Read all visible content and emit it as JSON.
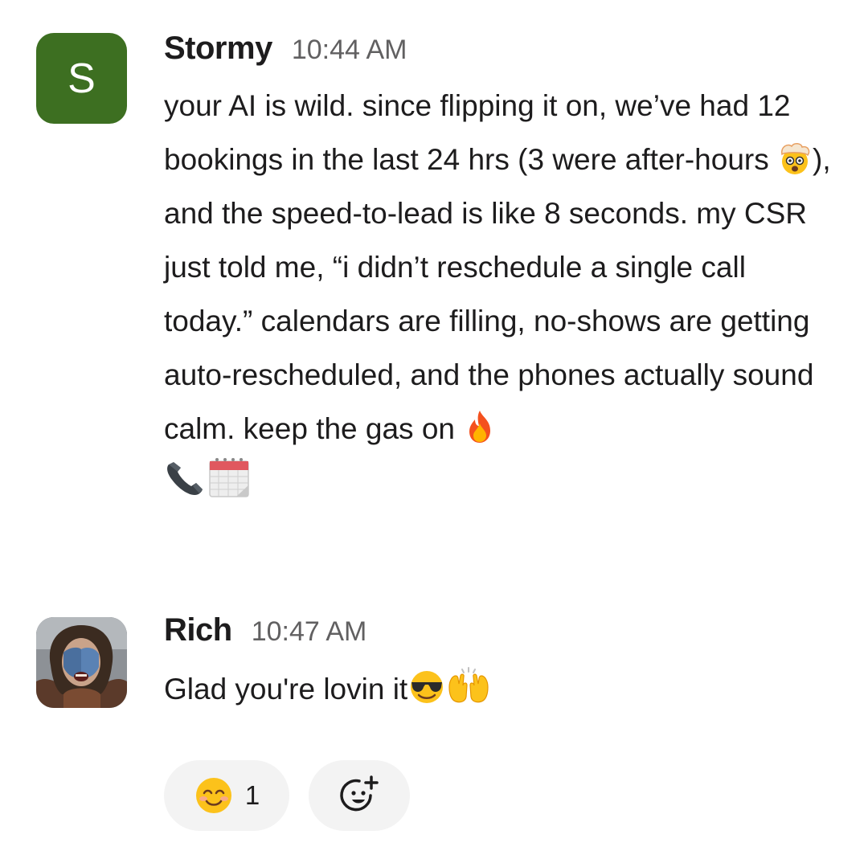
{
  "messages": [
    {
      "author": "Stormy",
      "time": "10:44 AM",
      "avatar_letter": "S",
      "avatar_color": "#3d6f21",
      "text_parts": [
        "your AI is wild. since flipping it on, we’ve had 12 bookings in the last 24 hrs (3 were after-hours ",
        "), and the speed-to-lead is like 8 seconds. my CSR just told me, “i didn’t reschedule a single call today.” calendars are filling, no-shows are getting auto-rescheduled, and the phones actually sound calm. keep the gas on "
      ],
      "emojis": [
        "exploding-head-emoji",
        "fire-emoji",
        "telephone-receiver-emoji",
        "calendar-emoji"
      ]
    },
    {
      "author": "Rich",
      "time": "10:47 AM",
      "avatar": "profile-photo",
      "text_parts": [
        "Glad you're lovin it"
      ],
      "emojis": [
        "sunglasses-face-emoji",
        "raising-hands-emoji"
      ]
    }
  ],
  "reactions": [
    {
      "emoji": "smiling-face-emoji",
      "count": "1"
    }
  ],
  "add_reaction_icon": "add-reaction-icon"
}
